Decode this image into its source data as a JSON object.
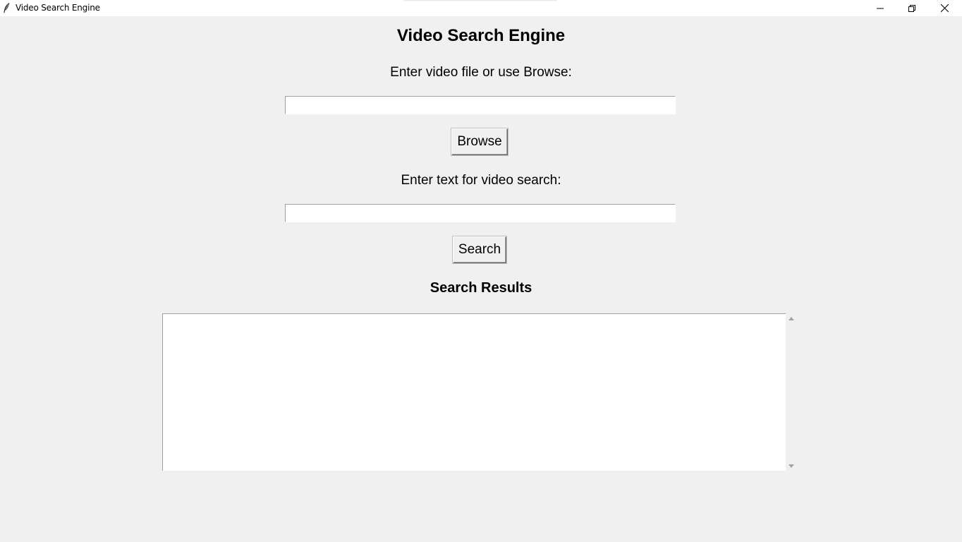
{
  "window": {
    "title": "Video Search Engine",
    "icon": "feather-icon"
  },
  "controls": {
    "minimize_icon": "minimize-icon",
    "maximize_icon": "restore-icon",
    "close_icon": "close-icon"
  },
  "main": {
    "title": "Video Search Engine",
    "video_label": "Enter video file or use Browse:",
    "video_value": "",
    "browse_label": "Browse",
    "text_label": "Enter text for video search:",
    "text_value": "",
    "search_label": "Search",
    "results_title": "Search Results",
    "results_text": ""
  }
}
